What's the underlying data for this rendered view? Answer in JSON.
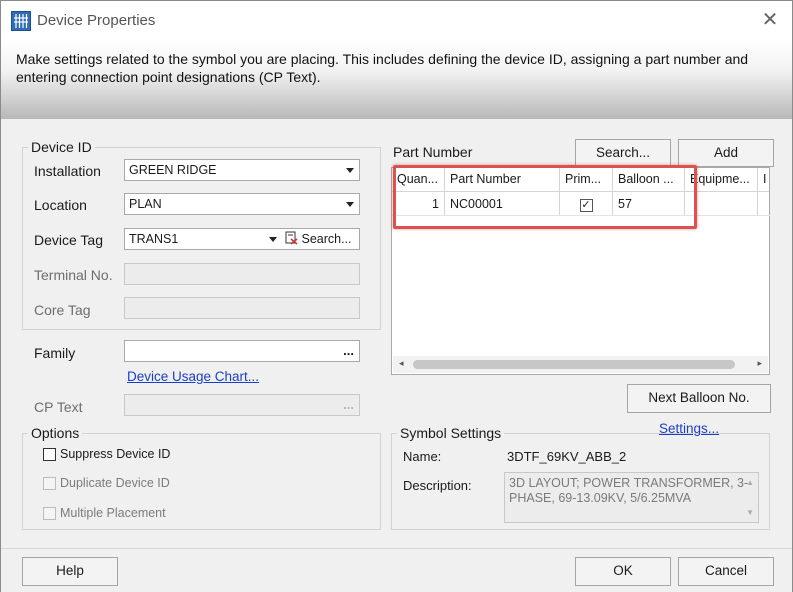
{
  "window": {
    "title": "Device Properties"
  },
  "banner": {
    "description": "Make settings related to the symbol you are placing. This includes defining the device ID, assigning a part number and entering connection point designations (CP Text)."
  },
  "device_id": {
    "group_label": "Device ID",
    "installation": {
      "label": "Installation",
      "value": "GREEN RIDGE"
    },
    "location": {
      "label": "Location",
      "value": "PLAN"
    },
    "device_tag": {
      "label": "Device Tag",
      "value": "TRANS1",
      "search_label": "Search..."
    },
    "terminal_no": {
      "label": "Terminal No.",
      "value": ""
    },
    "core_tag": {
      "label": "Core Tag",
      "value": ""
    }
  },
  "family": {
    "label": "Family",
    "value": "",
    "browse": "..."
  },
  "device_usage_link": "Device Usage Chart...",
  "cp_text": {
    "label": "CP Text",
    "value": "",
    "browse": "..."
  },
  "options": {
    "group_label": "Options",
    "suppress_device_id": "Suppress Device ID",
    "duplicate_device_id": "Duplicate Device ID",
    "multiple_placement": "Multiple Placement"
  },
  "part_number": {
    "label": "Part Number",
    "search_button": "Search...",
    "add_button": "Add",
    "columns": [
      "Quan...",
      "Part Number",
      "Prim...",
      "Balloon ...",
      "Equipme...",
      "I"
    ],
    "rows": [
      {
        "quantity": "1",
        "part_number": "NC00001",
        "primary": "✓",
        "balloon": "57",
        "equipment": ""
      }
    ]
  },
  "next_balloon_button": "Next Balloon No.",
  "symbol_settings": {
    "group_label": "Symbol Settings",
    "settings_link": "Settings...",
    "name_label": "Name:",
    "name_value": "3DTF_69KV_ABB_2",
    "description_label": "Description:",
    "description_value": "3D LAYOUT; POWER TRANSFORMER, 3-PHASE, 69-13.09KV, 5/6.25MVA"
  },
  "footer": {
    "help": "Help",
    "ok": "OK",
    "cancel": "Cancel"
  },
  "colors": {
    "highlight": "#d9534f",
    "link": "#1a3fc7"
  }
}
